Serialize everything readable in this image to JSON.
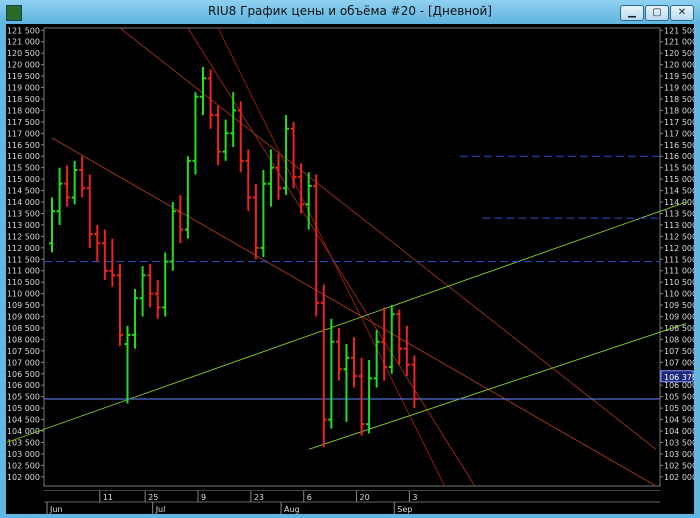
{
  "window": {
    "title": "RIU8 График цены и объёма #20 - [Дневной]",
    "controls": [
      "minimize",
      "restore",
      "close"
    ]
  },
  "chart_data": {
    "type": "candlestick",
    "instrument": "RIU8",
    "timeframe": "Дневной",
    "price_last": "106 370",
    "y_ticks": [
      "121 500",
      "121 000",
      "120 500",
      "120 000",
      "119 500",
      "119 000",
      "118 500",
      "118 000",
      "117 500",
      "117 000",
      "116 500",
      "116 000",
      "115 500",
      "115 000",
      "114 500",
      "114 000",
      "113 500",
      "113 000",
      "112 500",
      "112 000",
      "111 500",
      "111 000",
      "110 500",
      "110 000",
      "109 500",
      "109 000",
      "108 500",
      "108 000",
      "107 500",
      "107 000",
      "106 500",
      "106 000",
      "105 500",
      "105 000",
      "104 500",
      "104 000",
      "103 500",
      "103 000",
      "102 500",
      "102 000"
    ],
    "x_day_labels": [
      "11",
      "25",
      "9",
      "23",
      "6",
      "20",
      "3"
    ],
    "x_month_labels": [
      "Jun",
      "Jul",
      "Aug",
      "Sep"
    ],
    "ylim": [
      101600,
      121600
    ],
    "candles": [
      {
        "o": 112200,
        "h": 114200,
        "l": 111800,
        "c": 113600
      },
      {
        "o": 113600,
        "h": 115500,
        "l": 113000,
        "c": 114800
      },
      {
        "o": 114800,
        "h": 115600,
        "l": 113800,
        "c": 114200
      },
      {
        "o": 114200,
        "h": 115800,
        "l": 113900,
        "c": 115400
      },
      {
        "o": 115400,
        "h": 116000,
        "l": 114200,
        "c": 114600
      },
      {
        "o": 114600,
        "h": 115200,
        "l": 112000,
        "c": 112600
      },
      {
        "o": 112600,
        "h": 113000,
        "l": 111400,
        "c": 112200
      },
      {
        "o": 112200,
        "h": 112800,
        "l": 110600,
        "c": 111000
      },
      {
        "o": 111000,
        "h": 112400,
        "l": 110300,
        "c": 110800
      },
      {
        "o": 110800,
        "h": 111300,
        "l": 107700,
        "c": 108200
      },
      {
        "o": 107800,
        "h": 108600,
        "l": 105200,
        "c": 108200
      },
      {
        "o": 108200,
        "h": 110200,
        "l": 107600,
        "c": 109800
      },
      {
        "o": 109800,
        "h": 111200,
        "l": 109000,
        "c": 110800
      },
      {
        "o": 110800,
        "h": 111300,
        "l": 109400,
        "c": 110000
      },
      {
        "o": 110000,
        "h": 110600,
        "l": 108900,
        "c": 109400
      },
      {
        "o": 109400,
        "h": 111800,
        "l": 109000,
        "c": 111400
      },
      {
        "o": 111400,
        "h": 114000,
        "l": 111000,
        "c": 113600
      },
      {
        "o": 113600,
        "h": 114300,
        "l": 112200,
        "c": 112800
      },
      {
        "o": 112800,
        "h": 116000,
        "l": 112400,
        "c": 115800
      },
      {
        "o": 115800,
        "h": 118800,
        "l": 115200,
        "c": 118600
      },
      {
        "o": 118600,
        "h": 119900,
        "l": 117800,
        "c": 119400
      },
      {
        "o": 119400,
        "h": 119800,
        "l": 117200,
        "c": 117800
      },
      {
        "o": 117800,
        "h": 118200,
        "l": 115600,
        "c": 116200
      },
      {
        "o": 116200,
        "h": 117600,
        "l": 115800,
        "c": 117000
      },
      {
        "o": 117000,
        "h": 118800,
        "l": 116400,
        "c": 118000
      },
      {
        "o": 118000,
        "h": 118400,
        "l": 115300,
        "c": 115800
      },
      {
        "o": 115800,
        "h": 116300,
        "l": 113600,
        "c": 114200
      },
      {
        "o": 114200,
        "h": 114800,
        "l": 111500,
        "c": 112000
      },
      {
        "o": 112000,
        "h": 115400,
        "l": 111600,
        "c": 114800
      },
      {
        "o": 114800,
        "h": 116300,
        "l": 113800,
        "c": 115500
      },
      {
        "o": 115500,
        "h": 116100,
        "l": 114100,
        "c": 114600
      },
      {
        "o": 114600,
        "h": 117800,
        "l": 114300,
        "c": 117200
      },
      {
        "o": 117200,
        "h": 117500,
        "l": 114600,
        "c": 115100
      },
      {
        "o": 115100,
        "h": 115700,
        "l": 113500,
        "c": 113900
      },
      {
        "o": 113900,
        "h": 115300,
        "l": 112800,
        "c": 114700
      },
      {
        "o": 114700,
        "h": 115200,
        "l": 109000,
        "c": 109600
      },
      {
        "o": 109600,
        "h": 110400,
        "l": 103300,
        "c": 104500
      },
      {
        "o": 104500,
        "h": 108900,
        "l": 104100,
        "c": 107900
      },
      {
        "o": 107900,
        "h": 108500,
        "l": 106200,
        "c": 106700
      },
      {
        "o": 106700,
        "h": 107800,
        "l": 104400,
        "c": 107200
      },
      {
        "o": 107200,
        "h": 108100,
        "l": 105900,
        "c": 106400
      },
      {
        "o": 106400,
        "h": 107200,
        "l": 103800,
        "c": 104300
      },
      {
        "o": 104300,
        "h": 107100,
        "l": 103900,
        "c": 106300
      },
      {
        "o": 106300,
        "h": 108400,
        "l": 105900,
        "c": 107900
      },
      {
        "o": 107900,
        "h": 109400,
        "l": 106200,
        "c": 106800
      },
      {
        "o": 106800,
        "h": 109500,
        "l": 106500,
        "c": 109100
      },
      {
        "o": 109100,
        "h": 109300,
        "l": 106900,
        "c": 107600
      },
      {
        "o": 107600,
        "h": 108600,
        "l": 106400,
        "c": 106900
      },
      {
        "o": 106900,
        "h": 107300,
        "l": 105000,
        "c": 105400
      }
    ],
    "horizontal_lines": [
      {
        "y": 116000,
        "color": "#2255cc",
        "style": "dashed",
        "from": 54
      },
      {
        "y": 113300,
        "color": "#2255cc",
        "style": "dashed",
        "from": 57
      },
      {
        "y": 111400,
        "color": "#2255cc",
        "style": "dashed",
        "from": 0
      },
      {
        "y": 105400,
        "color": "#2255cc",
        "style": "dashed",
        "from": 0
      },
      {
        "y": 105400,
        "color": "#6688ff",
        "style": "solid",
        "from": 0
      }
    ]
  }
}
